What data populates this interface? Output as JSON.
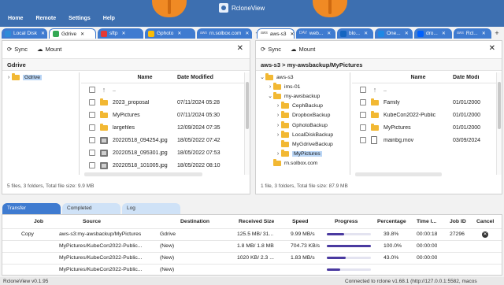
{
  "menubar": {
    "items": [
      "Home",
      "Remote",
      "Settings",
      "Help"
    ],
    "app_title": "RcloneView"
  },
  "left_tabs": [
    {
      "label": "Local Disk",
      "icon": "local-disk-icon",
      "color": "#2e8bd8"
    },
    {
      "label": "Gdrive",
      "icon": "gdrive-icon",
      "color": "#34a853",
      "active": true
    },
    {
      "label": "sftp",
      "icon": "sftp-icon",
      "color": "#e53935"
    },
    {
      "label": "Gphoto",
      "icon": "gphoto-icon",
      "color": "#fbbc05"
    },
    {
      "label": "rn.solbox.com",
      "icon": "aws-icon",
      "color": "#555555",
      "prefix": "aws"
    }
  ],
  "right_tabs": [
    {
      "label": "aws-s3",
      "icon": "aws-icon",
      "color": "#555555",
      "prefix": "aws",
      "active": true
    },
    {
      "label": "web...",
      "icon": "webdav-icon",
      "color": "#3949ab",
      "prefix": "DAV"
    },
    {
      "label": "blo...",
      "icon": "blob-icon",
      "color": "#1565c0"
    },
    {
      "label": "One...",
      "icon": "onedrive-icon",
      "color": "#1e88e5"
    },
    {
      "label": "dro...",
      "icon": "dropbox-icon",
      "color": "#0061fe"
    },
    {
      "label": "Rcl...",
      "icon": "aws-icon",
      "color": "#555555",
      "prefix": "aws"
    }
  ],
  "toolbar": {
    "sync": "Sync",
    "mount": "Mount"
  },
  "left_pane": {
    "path": "Gdrive",
    "tree": [
      {
        "label": "Gdrive",
        "selected": true
      }
    ],
    "columns": {
      "name": "Name",
      "date": "Date Modified"
    },
    "files": [
      {
        "name": "..",
        "date": "",
        "type": "up"
      },
      {
        "name": "2023_proposal",
        "date": "07/11/2024 05:28",
        "type": "folder"
      },
      {
        "name": "MyPictures",
        "date": "07/11/2024 05:30",
        "type": "folder"
      },
      {
        "name": "largefiles",
        "date": "12/09/2024 07:35",
        "type": "folder"
      },
      {
        "name": "20220518_094254.jpg",
        "date": "18/05/2022 07:42",
        "type": "image"
      },
      {
        "name": "20220518_095301.jpg",
        "date": "18/05/2022 07:53",
        "type": "image"
      },
      {
        "name": "20220518_101005.jpg",
        "date": "18/05/2022 08:10",
        "type": "image"
      }
    ],
    "status": "5 files, 3 folders, Total file size: 9.9 MB"
  },
  "right_pane": {
    "path": "aws-s3 > my-awsbackup/MyPictures",
    "tree": [
      {
        "label": "aws-s3",
        "level": 0,
        "chev": "v"
      },
      {
        "label": "ims-01",
        "level": 1,
        "chev": ">"
      },
      {
        "label": "my-awsbackup",
        "level": 1,
        "chev": "v"
      },
      {
        "label": "CephBackup",
        "level": 2,
        "chev": ">"
      },
      {
        "label": "DropboxBackup",
        "level": 2,
        "chev": ">"
      },
      {
        "label": "GphotoBackup",
        "level": 2,
        "chev": ">"
      },
      {
        "label": "LocalDiskBackup",
        "level": 2,
        "chev": ">"
      },
      {
        "label": "MyGdriveBackup",
        "level": 2,
        "chev": ""
      },
      {
        "label": "MyPictures",
        "level": 2,
        "chev": ">",
        "selected": true
      },
      {
        "label": "rn.solbox.com",
        "level": 1,
        "chev": ""
      }
    ],
    "columns": {
      "name": "Name",
      "date": "Date Modi"
    },
    "files": [
      {
        "name": "..",
        "date": "",
        "type": "up"
      },
      {
        "name": "Family",
        "date": "01/01/2000",
        "type": "folder"
      },
      {
        "name": "KubeCon2022-Public",
        "date": "01/01/2000",
        "type": "folder"
      },
      {
        "name": "MyPictures",
        "date": "01/01/2000",
        "type": "folder"
      },
      {
        "name": "mainbg.mov",
        "date": "03/09/2024",
        "type": "file"
      }
    ],
    "status": "1 file, 3 folders, Total file size: 87.9 MB"
  },
  "bottom_tabs": [
    "Transfer",
    "Completed",
    "Log"
  ],
  "transfer": {
    "columns": [
      "Job",
      "Source",
      "Destination",
      "Received Size",
      "Speed",
      "Progress",
      "Percentage",
      "Time l...",
      "Job ID",
      "Cancel"
    ],
    "rows": [
      {
        "job": "Copy",
        "source": "aws-s3:my-awsbackup/MyPictures",
        "destination": "Gdrive",
        "received": "125.5 MB/ 31...",
        "speed": "9.99 MB/s",
        "progress": 0.398,
        "percentage": "39.8%",
        "time": "00:00:18",
        "job_id": "27296",
        "main": true
      },
      {
        "job": "",
        "source": "MyPictures/KubeCon2022-Public...",
        "destination": "(New)",
        "received": "1.8 MB/ 1.8 MB",
        "speed": "704.73 KB/s",
        "progress": 1.0,
        "percentage": "100.0%",
        "time": "00:00:00",
        "job_id": ""
      },
      {
        "job": "",
        "source": "MyPictures/KubeCon2022-Public...",
        "destination": "(New)",
        "received": "1020 KB/ 2.3 ...",
        "speed": "1.83 MB/s",
        "progress": 0.43,
        "percentage": "43.0%",
        "time": "00:00:00",
        "job_id": ""
      },
      {
        "job": "",
        "source": "MyPictures/KubeCon2022-Public...",
        "destination": "(New)",
        "received": "",
        "speed": "",
        "progress": 0.3,
        "percentage": "",
        "time": "",
        "job_id": ""
      }
    ]
  },
  "statusbar": {
    "version": "RcloneView v0.1.95",
    "connection": "Connected to rclone v1.68.1 (http://127.0.0.1:5582, macos"
  }
}
